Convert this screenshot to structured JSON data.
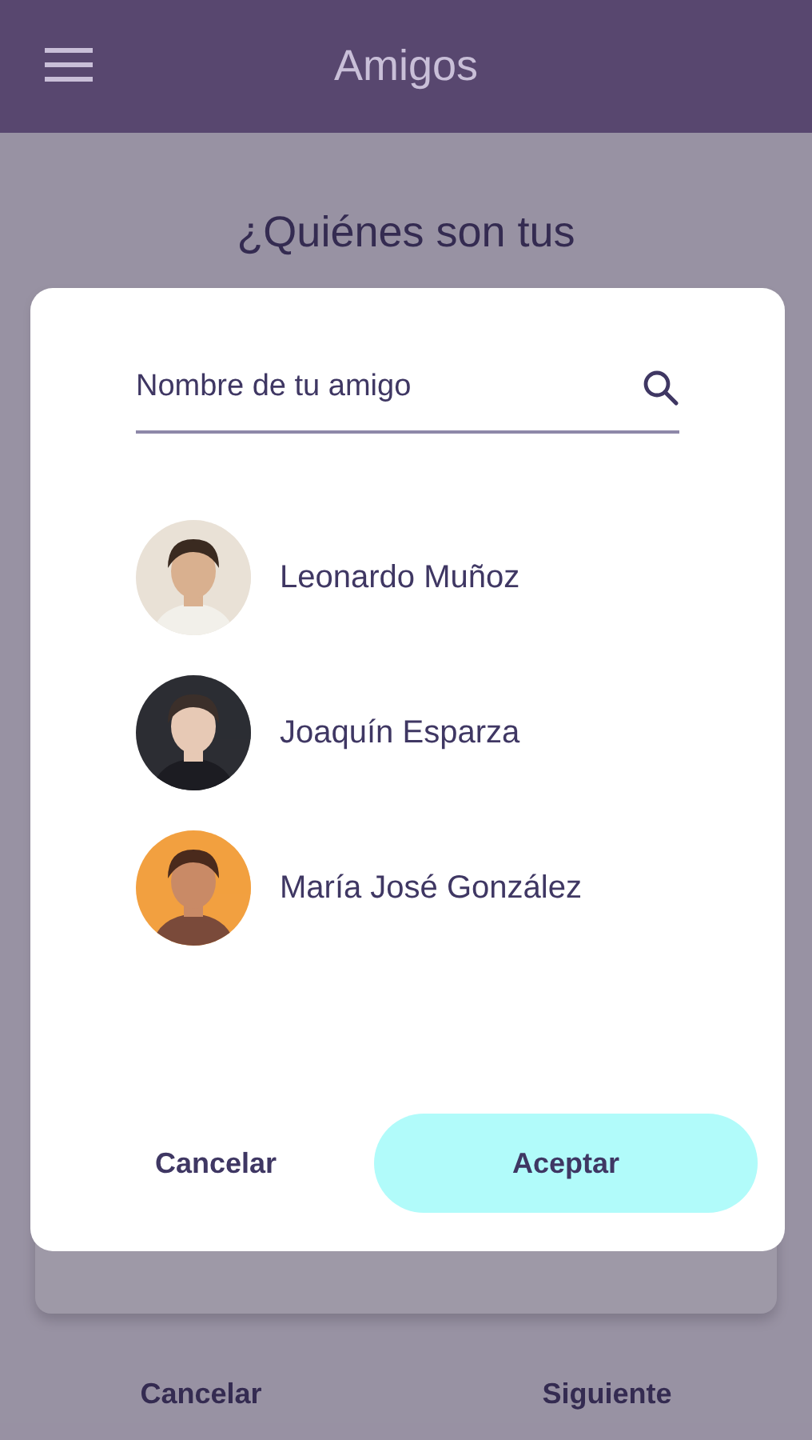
{
  "app_bar": {
    "title": "Amigos"
  },
  "background": {
    "question": "¿Quiénes son tus",
    "buttons": [
      {
        "label": "Cancelar"
      },
      {
        "label": "Siguiente"
      }
    ]
  },
  "dialog": {
    "search": {
      "placeholder": "Nombre de tu amigo"
    },
    "friends": [
      {
        "name": "Leonardo Muñoz",
        "kind": "picture"
      },
      {
        "name": "Joaquín Esparza",
        "kind": "picture"
      },
      {
        "name": "María José González",
        "kind": "picture"
      }
    ],
    "buttons": [
      {
        "label": "Cancelar",
        "kind": "text"
      },
      {
        "label": "Aceptar",
        "kind": "filled"
      }
    ]
  }
}
